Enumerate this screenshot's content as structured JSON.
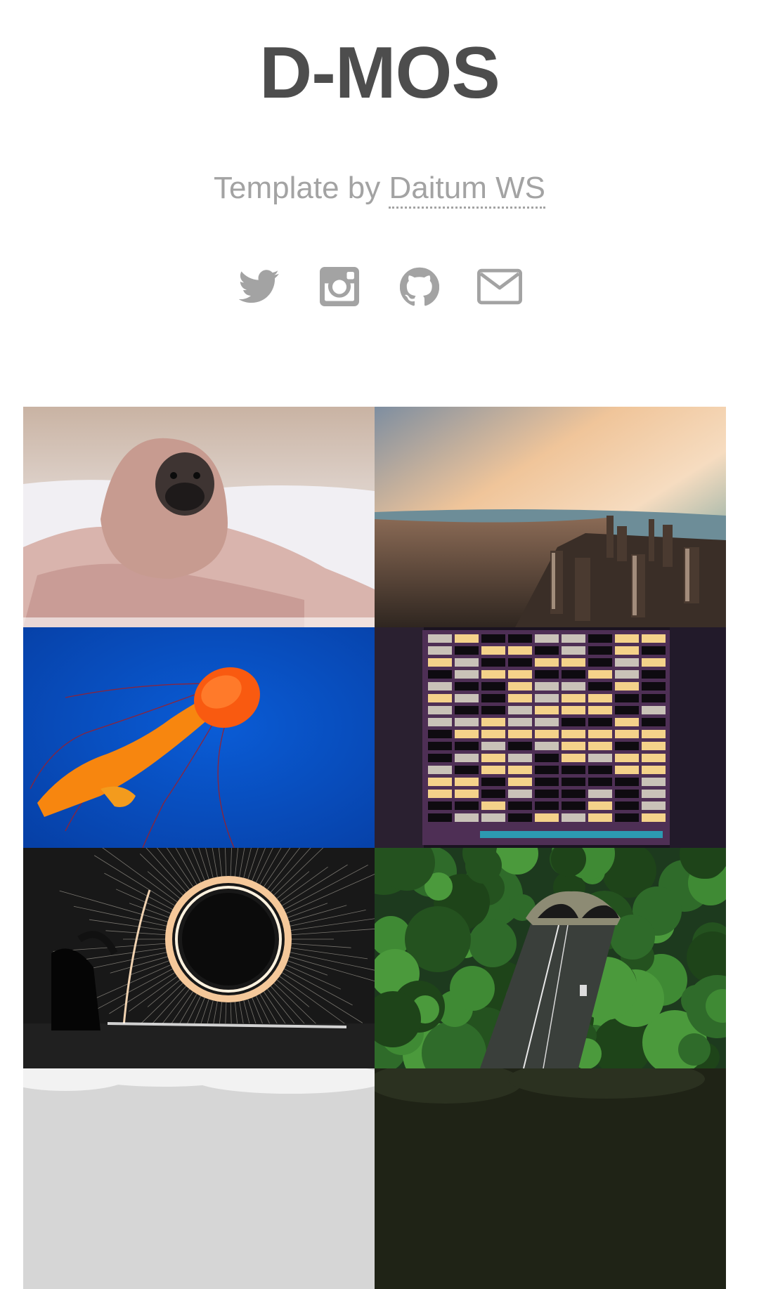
{
  "header": {
    "title": "D-MOS",
    "subtitle_prefix": "Template by",
    "subtitle_link": "Daitum WS"
  },
  "social": [
    {
      "icon": "twitter-icon"
    },
    {
      "icon": "instagram-icon"
    },
    {
      "icon": "github-icon"
    },
    {
      "icon": "envelope-icon"
    }
  ],
  "gallery": [
    {
      "subject": "pug-in-blanket"
    },
    {
      "subject": "city-skyline-sunset"
    },
    {
      "subject": "orange-jellyfish"
    },
    {
      "subject": "office-building-night"
    },
    {
      "subject": "steel-wool-light-circle"
    },
    {
      "subject": "forest-tunnel-road"
    },
    {
      "subject": "clouds"
    },
    {
      "subject": "dark-forest"
    }
  ],
  "colors": {
    "title": "#4d4d4d",
    "muted": "#a3a3a3",
    "background": "#ffffff"
  }
}
